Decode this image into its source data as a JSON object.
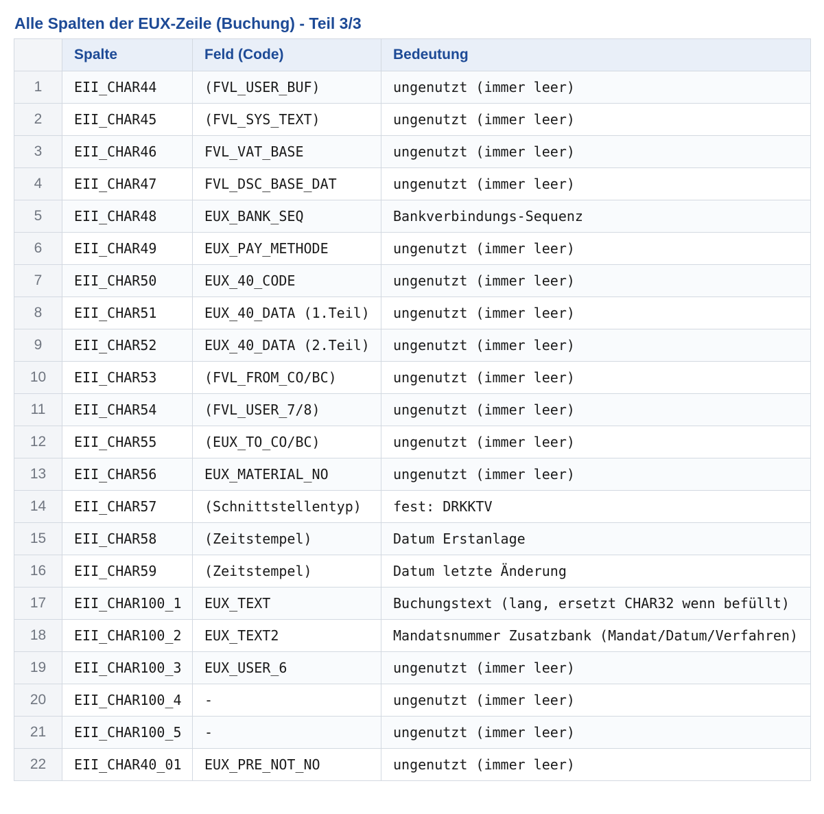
{
  "title": "Alle Spalten der EUX-Zeile (Buchung) - Teil 3/3",
  "table": {
    "headers": [
      "",
      "Spalte",
      "Feld (Code)",
      "Bedeutung"
    ],
    "rows": [
      {
        "num": "1",
        "spalte": "EII_CHAR44",
        "feld": "(FVL_USER_BUF)",
        "bedeutung": "ungenutzt (immer leer)"
      },
      {
        "num": "2",
        "spalte": "EII_CHAR45",
        "feld": "(FVL_SYS_TEXT)",
        "bedeutung": "ungenutzt (immer leer)"
      },
      {
        "num": "3",
        "spalte": "EII_CHAR46",
        "feld": "FVL_VAT_BASE",
        "bedeutung": "ungenutzt (immer leer)"
      },
      {
        "num": "4",
        "spalte": "EII_CHAR47",
        "feld": "FVL_DSC_BASE_DAT",
        "bedeutung": "ungenutzt (immer leer)"
      },
      {
        "num": "5",
        "spalte": "EII_CHAR48",
        "feld": "EUX_BANK_SEQ",
        "bedeutung": "Bankverbindungs-Sequenz"
      },
      {
        "num": "6",
        "spalte": "EII_CHAR49",
        "feld": "EUX_PAY_METHODE",
        "bedeutung": "ungenutzt (immer leer)"
      },
      {
        "num": "7",
        "spalte": "EII_CHAR50",
        "feld": "EUX_40_CODE",
        "bedeutung": "ungenutzt (immer leer)"
      },
      {
        "num": "8",
        "spalte": "EII_CHAR51",
        "feld": "EUX_40_DATA (1.Teil)",
        "bedeutung": "ungenutzt (immer leer)"
      },
      {
        "num": "9",
        "spalte": "EII_CHAR52",
        "feld": "EUX_40_DATA (2.Teil)",
        "bedeutung": "ungenutzt (immer leer)"
      },
      {
        "num": "10",
        "spalte": "EII_CHAR53",
        "feld": "(FVL_FROM_CO/BC)",
        "bedeutung": "ungenutzt (immer leer)"
      },
      {
        "num": "11",
        "spalte": "EII_CHAR54",
        "feld": "(FVL_USER_7/8)",
        "bedeutung": "ungenutzt (immer leer)"
      },
      {
        "num": "12",
        "spalte": "EII_CHAR55",
        "feld": "(EUX_TO_CO/BC)",
        "bedeutung": "ungenutzt (immer leer)"
      },
      {
        "num": "13",
        "spalte": "EII_CHAR56",
        "feld": "EUX_MATERIAL_NO",
        "bedeutung": "ungenutzt (immer leer)"
      },
      {
        "num": "14",
        "spalte": "EII_CHAR57",
        "feld": "(Schnittstellentyp)",
        "bedeutung": "fest: DRKKTV"
      },
      {
        "num": "15",
        "spalte": "EII_CHAR58",
        "feld": "(Zeitstempel)",
        "bedeutung": "Datum Erstanlage"
      },
      {
        "num": "16",
        "spalte": "EII_CHAR59",
        "feld": "(Zeitstempel)",
        "bedeutung": "Datum letzte Änderung"
      },
      {
        "num": "17",
        "spalte": "EII_CHAR100_1",
        "feld": "EUX_TEXT",
        "bedeutung": "Buchungstext (lang, ersetzt CHAR32 wenn befüllt)"
      },
      {
        "num": "18",
        "spalte": "EII_CHAR100_2",
        "feld": "EUX_TEXT2",
        "bedeutung": "Mandatsnummer Zusatzbank (Mandat/Datum/Verfahren)"
      },
      {
        "num": "19",
        "spalte": "EII_CHAR100_3",
        "feld": "EUX_USER_6",
        "bedeutung": "ungenutzt (immer leer)"
      },
      {
        "num": "20",
        "spalte": "EII_CHAR100_4",
        "feld": "-",
        "bedeutung": "ungenutzt (immer leer)"
      },
      {
        "num": "21",
        "spalte": "EII_CHAR100_5",
        "feld": "-",
        "bedeutung": "ungenutzt (immer leer)"
      },
      {
        "num": "22",
        "spalte": "EII_CHAR40_01",
        "feld": "EUX_PRE_NOT_NO",
        "bedeutung": "ungenutzt (immer leer)"
      }
    ]
  }
}
